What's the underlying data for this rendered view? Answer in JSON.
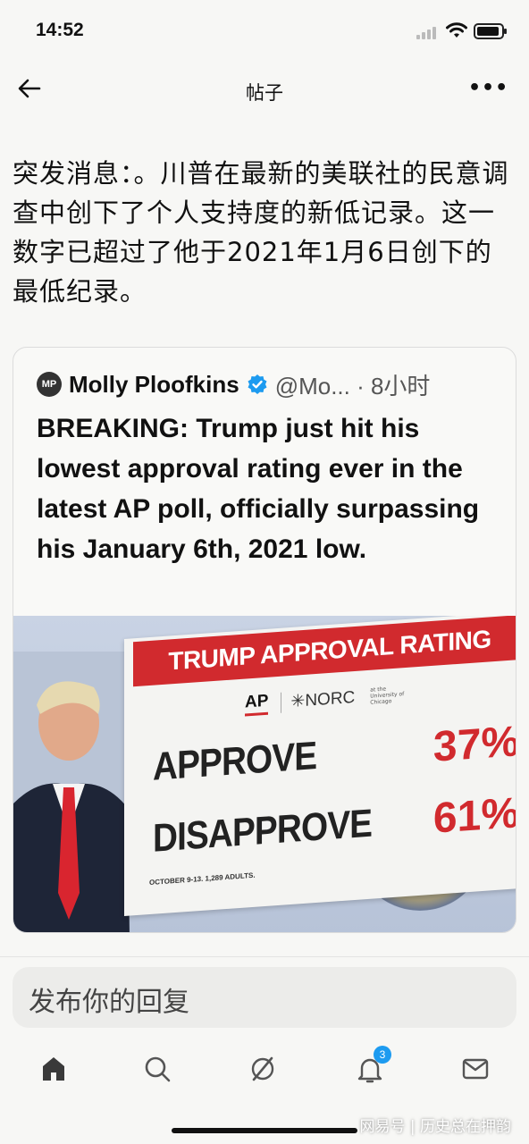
{
  "status_bar": {
    "time": "14:52"
  },
  "nav": {
    "title": "帖子"
  },
  "post": {
    "text": "突发消息：。川普在最新的美联社的民意调查中创下了个人支持度的新低记录。这一数字已超过了他于2021年1月6日创下的最低纪录。"
  },
  "quote": {
    "avatar_initials": "MP",
    "author": "Molly Ploofkins",
    "handle": "@Mo... · 8小时",
    "body": "BREAKING: Trump just hit his lowest approval rating ever in the latest AP poll, officially surpassing his January 6th, 2021 low."
  },
  "poll_image": {
    "header": "TRUMP APPROVAL RATING",
    "ap_logo": "AP",
    "norc_logo": "✳NORC",
    "norc_sub": "at the University of Chicago",
    "rows": [
      {
        "label": "APPROVE",
        "value": "37%"
      },
      {
        "label": "DISAPPROVE",
        "value": "61%"
      }
    ],
    "note": "OCTOBER 9-13. 1,289 ADULTS."
  },
  "reply": {
    "placeholder": "发布你的回复"
  },
  "tabs": {
    "notification_count": "3"
  },
  "watermark": "网易号 | 历史总在押韵",
  "colors": {
    "accent": "#1d9bf0",
    "poll_red": "#d12a2e"
  }
}
